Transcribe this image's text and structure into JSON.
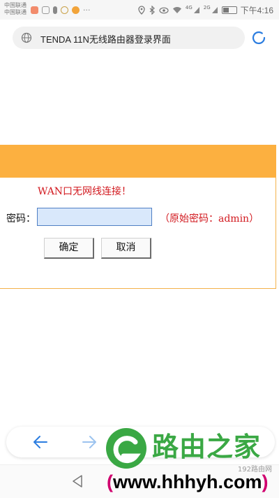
{
  "status_bar": {
    "carrier_1": "中国联通",
    "carrier_2": "中国联通",
    "dots": "···",
    "net_4g": "4G",
    "net_2g": "2G",
    "time": "下午4:16"
  },
  "browser": {
    "page_title": "TENDA 11N无线路由器登录界面"
  },
  "login": {
    "wan_message": "WAN口无网线连接！",
    "password_label": "密码：",
    "password_value": "",
    "password_hint": "（原始密码：admin）",
    "confirm_label": "确定",
    "cancel_label": "取消"
  },
  "watermark": {
    "title": "路由之家",
    "small": "192路由网",
    "url_open": "(",
    "url": "www.hhhyh.com",
    "url_close": ")"
  },
  "colors": {
    "header_orange": "#fcb040",
    "message_red": "#d2191f",
    "browser_blue": "#2b7de0",
    "logo_green": "#3aa844"
  },
  "icons": [
    "globe-icon",
    "reload-icon",
    "back-arrow-icon",
    "forward-arrow-icon",
    "system-back-icon",
    "wifi-icon",
    "battery-icon",
    "location-icon",
    "bluetooth-icon",
    "eye-icon"
  ]
}
